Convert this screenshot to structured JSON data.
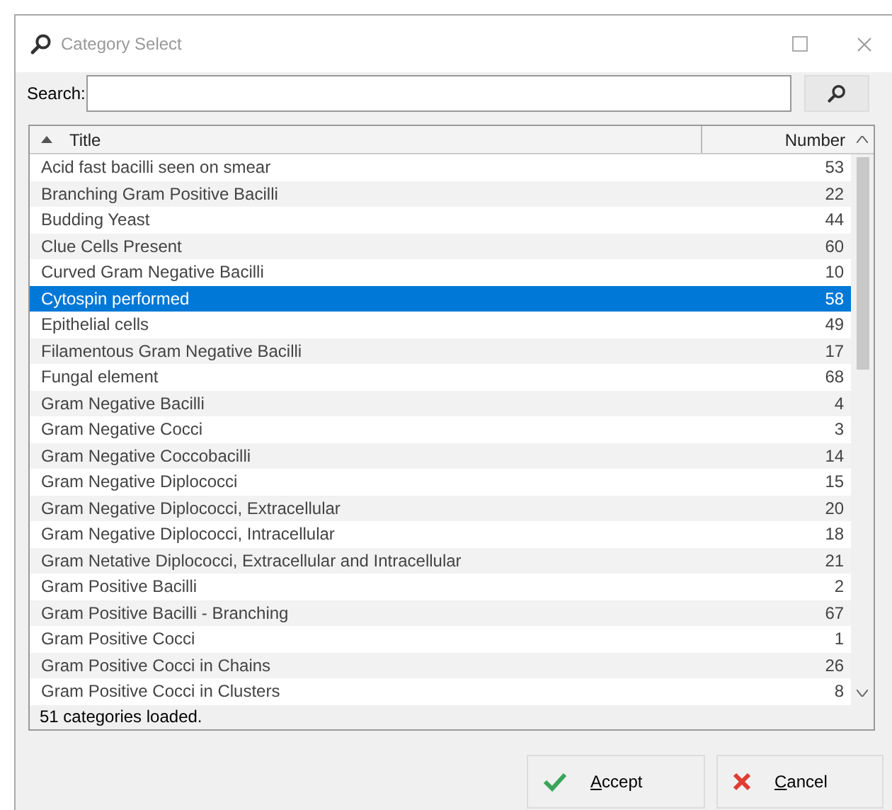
{
  "window": {
    "title": "Category Select"
  },
  "search": {
    "label": "Search:"
  },
  "table": {
    "columns": [
      {
        "label": "Title",
        "sorted": true
      },
      {
        "label": "Number",
        "sorted": false
      }
    ],
    "rows": [
      {
        "title": "Acid fast bacilli seen on smear",
        "number": "53",
        "selected": false
      },
      {
        "title": "Branching Gram Positive Bacilli",
        "number": "22",
        "selected": false
      },
      {
        "title": "Budding Yeast",
        "number": "44",
        "selected": false
      },
      {
        "title": "Clue Cells Present",
        "number": "60",
        "selected": false
      },
      {
        "title": "Curved Gram Negative Bacilli",
        "number": "10",
        "selected": false
      },
      {
        "title": "Cytospin performed",
        "number": "58",
        "selected": true
      },
      {
        "title": "Epithelial cells",
        "number": "49",
        "selected": false
      },
      {
        "title": "Filamentous Gram Negative Bacilli",
        "number": "17",
        "selected": false
      },
      {
        "title": "Fungal element",
        "number": "68",
        "selected": false
      },
      {
        "title": "Gram Negative Bacilli",
        "number": "4",
        "selected": false
      },
      {
        "title": "Gram Negative Cocci",
        "number": "3",
        "selected": false
      },
      {
        "title": "Gram Negative Coccobacilli",
        "number": "14",
        "selected": false
      },
      {
        "title": "Gram Negative Diplococci",
        "number": "15",
        "selected": false
      },
      {
        "title": "Gram Negative Diplococci, Extracellular",
        "number": "20",
        "selected": false
      },
      {
        "title": "Gram Negative Diplococci, Intracellular",
        "number": "18",
        "selected": false
      },
      {
        "title": "Gram Netative Diplococci, Extracellular and Intracellular",
        "number": "21",
        "selected": false
      },
      {
        "title": "Gram Positive Bacilli",
        "number": "2",
        "selected": false
      },
      {
        "title": "Gram Positive Bacilli - Branching",
        "number": "67",
        "selected": false
      },
      {
        "title": "Gram Positive Cocci",
        "number": "1",
        "selected": false
      },
      {
        "title": "Gram Positive Cocci in Chains",
        "number": "26",
        "selected": false
      },
      {
        "title": "Gram Positive Cocci in Clusters",
        "number": "8",
        "selected": false
      }
    ]
  },
  "status_bar": "51 categories loaded.",
  "buttons": [
    {
      "label": "Accept",
      "kind": "accept"
    },
    {
      "label": "Cancel",
      "kind": "cancel"
    }
  ]
}
